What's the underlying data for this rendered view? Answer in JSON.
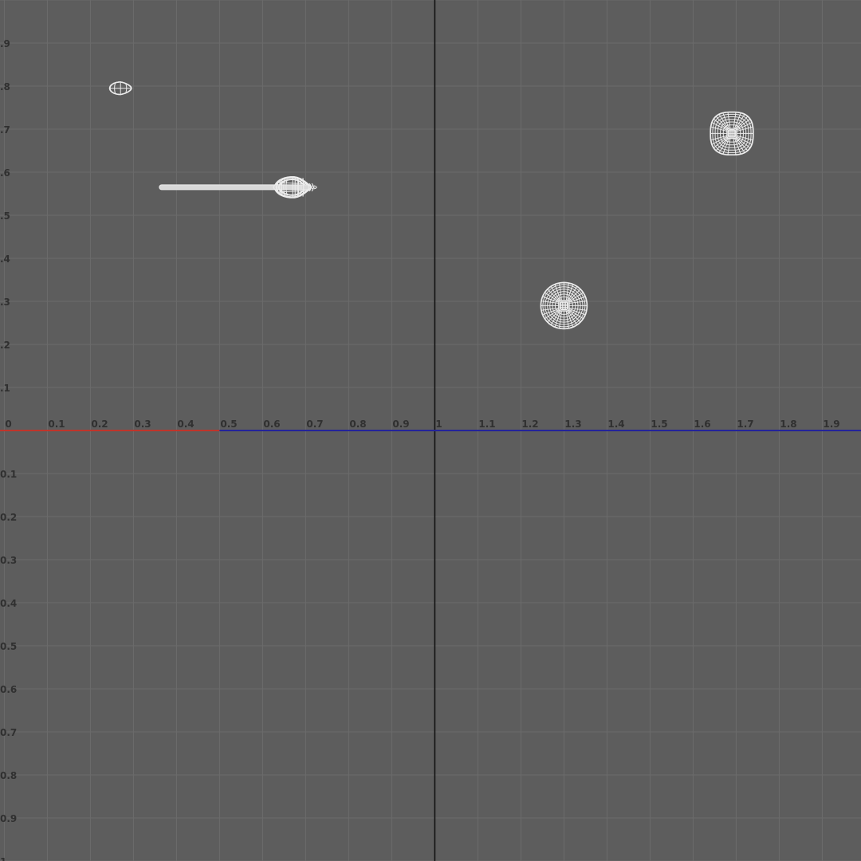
{
  "viewport": {
    "background_color": "#5d5d5d",
    "grid_color": "#6b6b6b",
    "grid_major_color": "#545454",
    "v_axis_color": "#111111",
    "u_axis_red_color": "#c0342a",
    "u_axis_blue_color": "#23239a",
    "wire_color": "#ececec",
    "u_range": [
      -0.01,
      1.99
    ],
    "v_range": [
      -1.0,
      1.0
    ],
    "grid_step": 0.1,
    "u_tick_labels": [
      {
        "value": 0.0,
        "label": "0"
      },
      {
        "value": 0.1,
        "label": "0.1"
      },
      {
        "value": 0.2,
        "label": "0.2"
      },
      {
        "value": 0.3,
        "label": "0.3"
      },
      {
        "value": 0.4,
        "label": "0.4"
      },
      {
        "value": 0.5,
        "label": "0.5"
      },
      {
        "value": 0.6,
        "label": "0.6"
      },
      {
        "value": 0.7,
        "label": "0.7"
      },
      {
        "value": 0.8,
        "label": "0.8"
      },
      {
        "value": 0.9,
        "label": "0.9"
      },
      {
        "value": 1.0,
        "label": "1"
      },
      {
        "value": 1.1,
        "label": "1.1"
      },
      {
        "value": 1.2,
        "label": "1.2"
      },
      {
        "value": 1.3,
        "label": "1.3"
      },
      {
        "value": 1.4,
        "label": "1.4"
      },
      {
        "value": 1.5,
        "label": "1.5"
      },
      {
        "value": 1.6,
        "label": "1.6"
      },
      {
        "value": 1.7,
        "label": "1.7"
      },
      {
        "value": 1.8,
        "label": "1.8"
      },
      {
        "value": 1.9,
        "label": "1.9"
      }
    ],
    "v_tick_labels": [
      {
        "value": 0.9,
        "label": ".9"
      },
      {
        "value": 0.8,
        "label": ".8"
      },
      {
        "value": 0.7,
        "label": ".7"
      },
      {
        "value": 0.6,
        "label": ".6"
      },
      {
        "value": 0.5,
        "label": ".5"
      },
      {
        "value": 0.4,
        "label": ".4"
      },
      {
        "value": 0.3,
        "label": ".3"
      },
      {
        "value": 0.2,
        "label": ".2"
      },
      {
        "value": 0.1,
        "label": ".1"
      },
      {
        "value": -0.1,
        "label": "0.1"
      },
      {
        "value": -0.2,
        "label": "0.2"
      },
      {
        "value": -0.3,
        "label": "0.3"
      },
      {
        "value": -0.4,
        "label": "0.4"
      },
      {
        "value": -0.5,
        "label": "0.5"
      },
      {
        "value": -0.6,
        "label": "0.6"
      },
      {
        "value": -0.7,
        "label": "0.7"
      },
      {
        "value": -0.8,
        "label": "0.8"
      },
      {
        "value": -0.9,
        "label": "0.9"
      },
      {
        "value": -1.0,
        "label": "1"
      }
    ]
  },
  "uv_shells": [
    {
      "name": "small-ellipse-shell",
      "shape": "egg",
      "center": [
        0.27,
        0.795
      ],
      "radius": [
        0.255,
        0.148
      ],
      "rings": 1,
      "spokes": 6
    },
    {
      "name": "leaf-shell",
      "shape": "leaf",
      "center": [
        0.67,
        0.565
      ],
      "radius": [
        0.42,
        0.245
      ],
      "rings": 2,
      "spokes": 10,
      "stem_start_u": 0.36
    },
    {
      "name": "radial-disc-shell-lower",
      "shape": "disc",
      "center": [
        1.3,
        0.29
      ],
      "radius": [
        0.54,
        0.54
      ],
      "rings": 7,
      "spokes": 32
    },
    {
      "name": "radial-disc-shell-upper",
      "shape": "rounded-square",
      "center": [
        1.69,
        0.69
      ],
      "radius": [
        0.5,
        0.5
      ],
      "rings": 6,
      "spokes": 30
    }
  ]
}
